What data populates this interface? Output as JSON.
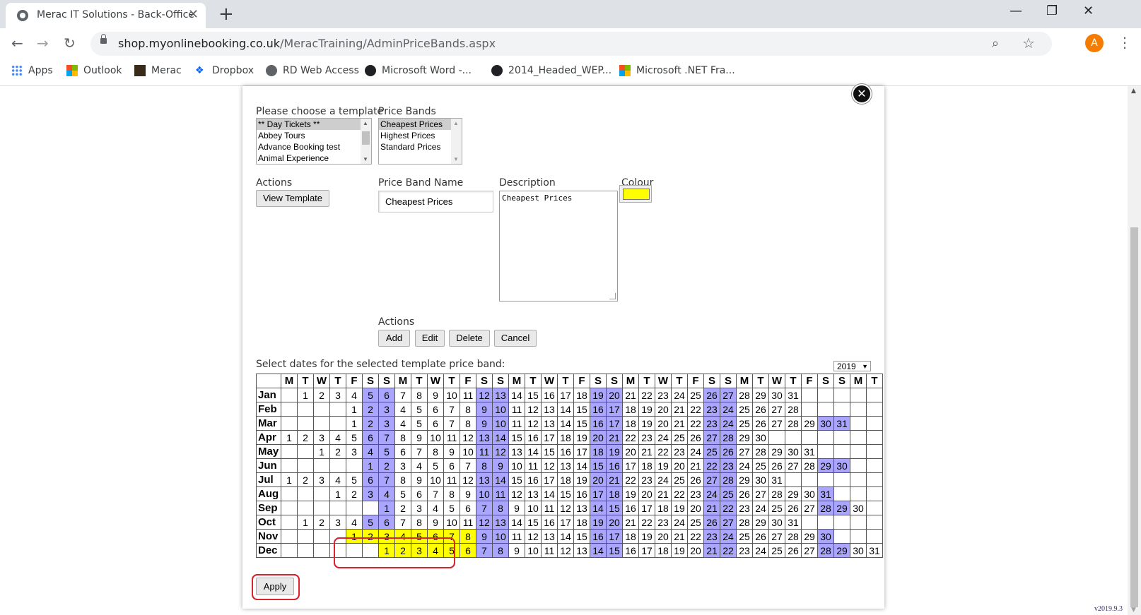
{
  "browser": {
    "tab_title": "Merac IT Solutions - Back-Office",
    "new_tab": "+",
    "url_host": "shop.myonlinebooking.co.uk",
    "url_path": "/MeracTraining/AdminPriceBands.aspx",
    "avatar_letter": "A",
    "bookmarks": [
      "Apps",
      "Outlook",
      "Merac",
      "Dropbox",
      "RD Web Access",
      "Microsoft Word -...",
      "2014_Headed_WEP...",
      "Microsoft .NET Fra..."
    ]
  },
  "dialog": {
    "template_label": "Please choose a template",
    "templates": [
      "** Day Tickets **",
      "Abbey Tours",
      "Advance Booking test",
      "Animal Experience"
    ],
    "selected_template": "** Day Tickets **",
    "price_bands_label": "Price Bands",
    "price_bands": [
      "Cheapest Prices",
      "Highest Prices",
      "Standard Prices"
    ],
    "selected_band": "Cheapest Prices",
    "actions_label": "Actions",
    "view_template_label": "View Template",
    "price_band_name_label": "Price Band Name",
    "price_band_name_value": "Cheapest Prices",
    "description_label": "Description",
    "description_value": "Cheapest Prices",
    "colour_label": "Colour",
    "colour_value": "#ffff00",
    "band_actions_label": "Actions",
    "add_label": "Add",
    "edit_label": "Edit",
    "delete_label": "Delete",
    "cancel_label": "Cancel",
    "calendar_label": "Select dates for the selected template price band:",
    "year": "2019",
    "apply_label": "Apply",
    "version": "v2019.9.3"
  },
  "calendar": {
    "day_headers": [
      "M",
      "T",
      "W",
      "T",
      "F",
      "S",
      "S",
      "M",
      "T",
      "W",
      "T",
      "F",
      "S",
      "S",
      "M",
      "T",
      "W",
      "T",
      "F",
      "S",
      "S",
      "M",
      "T",
      "W",
      "T",
      "F",
      "S",
      "S",
      "M",
      "T",
      "W",
      "T",
      "F",
      "S",
      "S",
      "M",
      "T"
    ],
    "months": [
      {
        "name": "Jan",
        "offset": 1,
        "days": 31
      },
      {
        "name": "Feb",
        "offset": 4,
        "days": 28
      },
      {
        "name": "Mar",
        "offset": 4,
        "days": 31
      },
      {
        "name": "Apr",
        "offset": 0,
        "days": 30
      },
      {
        "name": "May",
        "offset": 2,
        "days": 31
      },
      {
        "name": "Jun",
        "offset": 5,
        "days": 30
      },
      {
        "name": "Jul",
        "offset": 0,
        "days": 31
      },
      {
        "name": "Aug",
        "offset": 3,
        "days": 31
      },
      {
        "name": "Sep",
        "offset": 6,
        "days": 30
      },
      {
        "name": "Oct",
        "offset": 1,
        "days": 31
      },
      {
        "name": "Nov",
        "offset": 4,
        "days": 30
      },
      {
        "name": "Dec",
        "offset": 6,
        "days": 31
      }
    ],
    "weekend_color": "#aaa6ff",
    "selected_color": "#ffff00",
    "selected": {
      "Nov": [
        1,
        2,
        3,
        4,
        5,
        6,
        7,
        8
      ],
      "Dec": [
        1,
        2,
        3,
        4,
        5,
        6
      ]
    }
  }
}
